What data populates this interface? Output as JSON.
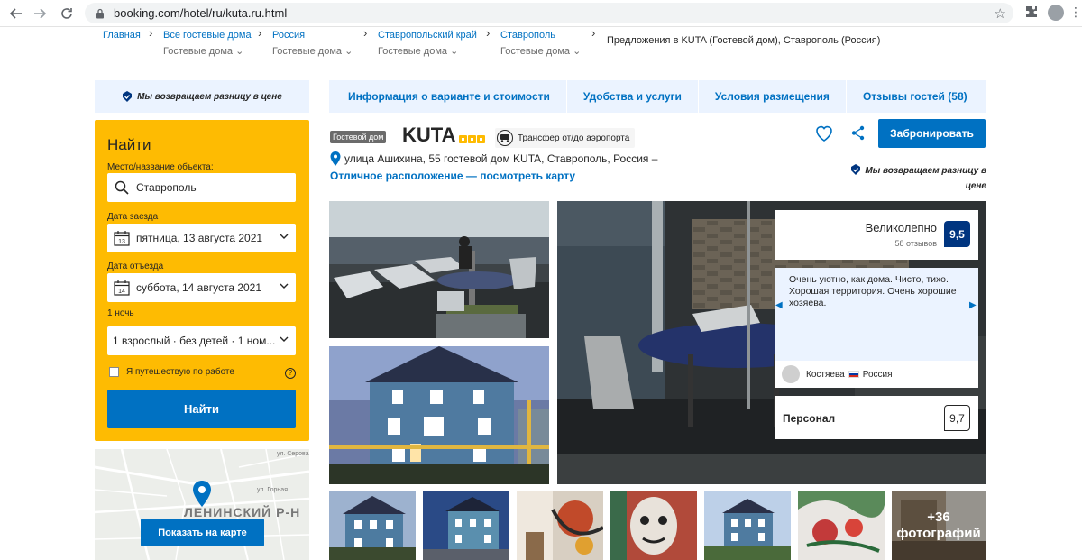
{
  "browser": {
    "url": "booking.com/hotel/ru/kuta.ru.html"
  },
  "breadcrumb": {
    "items": [
      {
        "label": "Главная",
        "sub": ""
      },
      {
        "label": "Все гостевые дома",
        "sub": "Гостевые дома"
      },
      {
        "label": "Россия",
        "sub": "Гостевые дома"
      },
      {
        "label": "Ставропольский край",
        "sub": "Гостевые дома"
      },
      {
        "label": "Ставрополь",
        "sub": "Гостевые дома"
      }
    ],
    "current": "Предложения в KUTA (Гостевой дом), Ставрополь (Россия)"
  },
  "sidebar": {
    "promise": "Мы возвращаем разницу в цене",
    "search": {
      "title": "Найти",
      "destination_label": "Место/название объекта:",
      "destination_value": "Ставрополь",
      "checkin_label": "Дата заезда",
      "checkin_value": "пятница, 13 августа 2021",
      "checkin_day": "13",
      "checkout_label": "Дата отъезда",
      "checkout_value": "суббота, 14 августа 2021",
      "checkout_day": "14",
      "nights": "1 ночь",
      "guests_value": "1 взрослый · без детей · 1 ном...",
      "work_trip_label": "Я путешествую по работе",
      "search_button": "Найти"
    },
    "map": {
      "district": "ЛЕНИНСКИЙ Р-Н",
      "street1": "ул. Горная",
      "street2": "ул. Серова",
      "button": "Показать на карте"
    }
  },
  "tabs": [
    {
      "label": "Информация о варианте и стоимости"
    },
    {
      "label": "Удобства и услуги"
    },
    {
      "label": "Условия размещения"
    },
    {
      "label": "Отзывы гостей (58)"
    }
  ],
  "hotel": {
    "type": "Гостевой дом",
    "name": "KUTA",
    "stars": 3,
    "transfer": "Трансфер от/до аэропорта",
    "address": "улица Ашихина, 55 гостевой дом KUTA, Ставрополь, Россия –",
    "map_link": "Отличное расположение — посмотреть карту",
    "book_button": "Забронировать",
    "promise": "Мы возвращаем разницу в цене"
  },
  "review": {
    "score_word": "Великолепно",
    "score_count": "58 отзывов",
    "score": "9,5",
    "text": "Очень уютно, как дома. Чисто, тихо. Хорошая территория. Очень хорошие хозяева.",
    "reviewer": "Костяева",
    "country": "Россия",
    "staff_label": "Персонал",
    "staff_score": "9,7"
  },
  "photos": {
    "more_count": "+36",
    "more_label": "фотографий"
  },
  "colors": {
    "brand_blue": "#0071c2",
    "dark_blue": "#003580",
    "yellow": "#febb02",
    "light_blue": "#ebf3ff"
  }
}
